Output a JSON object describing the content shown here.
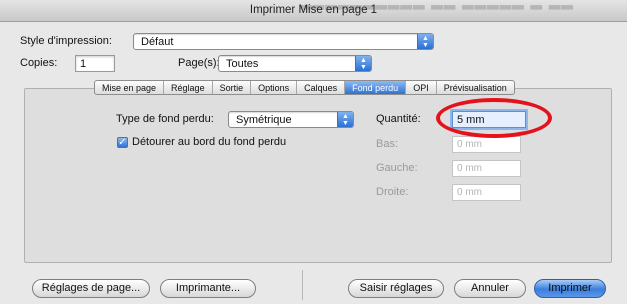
{
  "window": {
    "title": "Imprimer Mise en page 1"
  },
  "style_impression": {
    "label": "Style d'impression:",
    "value": "Défaut"
  },
  "copies": {
    "label": "Copies:",
    "value": "1"
  },
  "pages": {
    "label": "Page(s):",
    "value": "Toutes"
  },
  "tabs": [
    {
      "label": "Mise en page"
    },
    {
      "label": "Réglage"
    },
    {
      "label": "Sortie"
    },
    {
      "label": "Options"
    },
    {
      "label": "Calques"
    },
    {
      "label": "Fond perdu",
      "active": true
    },
    {
      "label": "OPI"
    },
    {
      "label": "Prévisualisation"
    }
  ],
  "fond_perdu": {
    "type_label": "Type de fond perdu:",
    "type_value": "Symétrique",
    "detourer_label": "Détourer au bord du fond perdu",
    "detourer_checked": true,
    "quantite_label": "Quantité:",
    "quantite_value": "5 mm",
    "bas_label": "Bas:",
    "bas_value": "0 mm",
    "gauche_label": "Gauche:",
    "gauche_value": "0 mm",
    "droite_label": "Droite:",
    "droite_value": "0 mm"
  },
  "buttons": {
    "reglages_page": "Réglages de page...",
    "imprimante": "Imprimante...",
    "saisir_reglages": "Saisir réglages",
    "annuler": "Annuler",
    "imprimer": "Imprimer"
  },
  "colors": {
    "accent": "#2f72d6",
    "highlight_ellipse": "#e3121d"
  }
}
